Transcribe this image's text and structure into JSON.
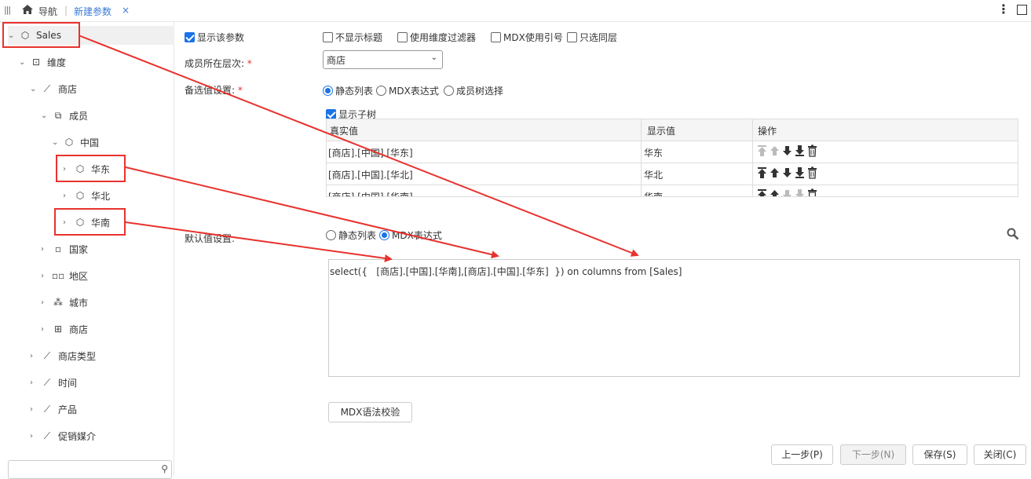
{
  "topbar": {
    "nav_label": "导航",
    "tab_label": "新建参数",
    "tab_close": "×"
  },
  "tree": {
    "root": "Sales",
    "items": [
      "维度",
      "商店",
      "成员",
      "中国",
      "华东",
      "华北",
      "华南",
      "国家",
      "地区",
      "城市",
      "商店",
      "商店类型",
      "时间",
      "产品",
      "促销媒介"
    ]
  },
  "form": {
    "show_param": "显示该参数",
    "hide_title": "不显示标题",
    "use_dim_filter": "使用维度过滤器",
    "mdx_quote": "MDX使用引号",
    "same_level": "只选同层",
    "level_label": "成员所在层次:",
    "level_value": "商店",
    "candidate_label": "备选值设置:",
    "cand_static": "静态列表",
    "cand_mdx": "MDX表达式",
    "cand_tree": "成员树选择",
    "show_subtree": "显示子树",
    "default_label": "默认值设置:",
    "def_static": "静态列表",
    "def_mdx": "MDX表达式",
    "mdx_text": "select({   [商店].[中国].[华南],[商店].[中国].[华东]  }) on columns from [Sales]",
    "validate_btn": "MDX语法校验"
  },
  "grid": {
    "headers": [
      "真实值",
      "显示值",
      "操作"
    ],
    "rows": [
      {
        "real": "[商店].[中国].[华东]",
        "display": "华东"
      },
      {
        "real": "[商店].[中国].[华北]",
        "display": "华北"
      },
      {
        "real": "[商店].[中国].[华南]",
        "display": "华南"
      }
    ]
  },
  "footer": {
    "prev": "上一步(P)",
    "next": "下一步(N)",
    "save": "保存(S)",
    "close": "关闭(C)"
  },
  "colors": {
    "accent": "#1a73e8",
    "highlight": "#e8322e",
    "tab": "#3a7bd5"
  }
}
